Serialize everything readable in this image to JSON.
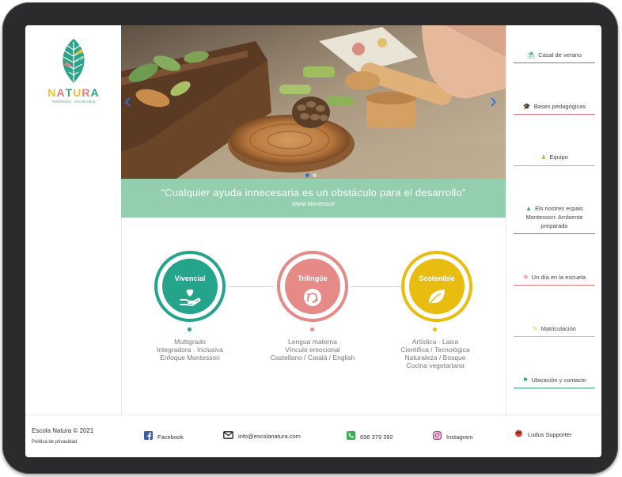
{
  "brand": {
    "name_letters": [
      "N",
      "A",
      "T",
      "U",
      "R",
      "A"
    ],
    "letter_colors": [
      "#e4c337",
      "#e57b7f",
      "#2aa389",
      "#e4c337",
      "#e57b7f",
      "#2aa389"
    ],
    "tagline": "montessori · escola laica"
  },
  "hero": {
    "quote": "\"Cualquier ayuda innecesaria es un obstáculo para el desarrollo\"",
    "author": "Maria Montessori",
    "slide_count": 2,
    "active_slide": 1
  },
  "features": [
    {
      "title": "Vivencial",
      "color": "#25a48c",
      "icon": "hand-heart-icon",
      "items": [
        "Multigrado",
        "Integradora · Inclusiva",
        "Enfoque Montessori"
      ]
    },
    {
      "title": "Trilingüe",
      "color": "#e58a86",
      "icon": "talking-head-icon",
      "items": [
        "Lengua materna",
        "Vínculo emocional",
        "Castellano / Català / English"
      ]
    },
    {
      "title": "Sostenible",
      "color": "#e9bd10",
      "icon": "leaf-icon",
      "items": [
        "Artística · Laica",
        "Científica / Tecnológica",
        "Naturaleza / Bosque",
        "Cocina vegetariana"
      ]
    }
  ],
  "menu": [
    {
      "label": "Casal de verano",
      "icon": "beach-umbrella-icon",
      "color": "#35a575"
    },
    {
      "label": "Bases pedagógicas",
      "icon": "graduation-cap-icon",
      "color": "#e0707a"
    },
    {
      "label": "Equipo",
      "icon": "team-icon",
      "color": "#d2b15b"
    },
    {
      "label": "Els nostres espais Montessori: Ambiente preparado",
      "icon": "tree-icon",
      "color": "#2aa389"
    },
    {
      "label": "Un día en la escuela",
      "icon": "sun-icon",
      "color": "#e57b7f"
    },
    {
      "label": "Matriculación",
      "icon": "form-pencil-icon",
      "color": "#e4c337"
    },
    {
      "label": "Ubicación y contacto",
      "icon": "location-icon",
      "color": "#35a575"
    }
  ],
  "footer": {
    "copyright": "Escola Natura © 2021",
    "privacy": "Política de privacidad",
    "facebook": "Facebook",
    "email": "info@escolanatura.com",
    "phone": "696 379 392",
    "instagram": "Instagram",
    "supporter": "Ludus Supporter"
  }
}
